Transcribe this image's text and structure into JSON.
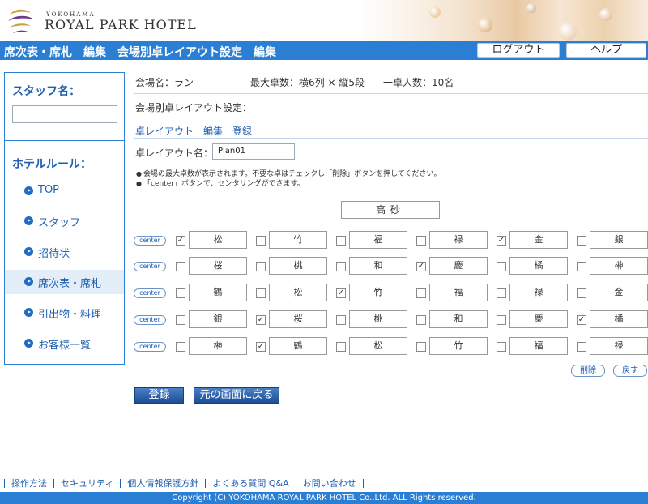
{
  "header": {
    "logo_small": "YOKOHAMA",
    "logo_big": "ROYAL PARK HOTEL"
  },
  "navbar": {
    "title": "席次表・席札　編集　会場別卓レイアウト設定　編集",
    "logout_label": "ログアウト",
    "help_label": "ヘルプ"
  },
  "sidebar": {
    "staff_label": "スタッフ名：",
    "rule_label": "ホテルルール：",
    "items": [
      {
        "label": "TOP"
      },
      {
        "label": "スタッフ"
      },
      {
        "label": "招待状"
      },
      {
        "label": "席次表・席札"
      },
      {
        "label": "引出物・料理"
      },
      {
        "label": "お客様一覧"
      }
    ]
  },
  "info": {
    "venue": "会場名：ラン",
    "max_tables": "最大卓数：横6列 × 縦5段",
    "per_table": "一卓人数：10名"
  },
  "section_title": "会場別卓レイアウト設定：",
  "crumb": "卓レイアウト　編集　登録",
  "layout_name_label": "卓レイアウト名：",
  "layout_name_value": "Plan01",
  "notes": [
    "会場の最大卓数が表示されます。不要な卓はチェックし「削除」ボタンを押してください。",
    "「center」ボタンで、センタリングができます。"
  ],
  "stage_label": "高砂",
  "center_label": "center",
  "grid": [
    [
      {
        "name": "松",
        "checked": true
      },
      {
        "name": "竹",
        "checked": false
      },
      {
        "name": "福",
        "checked": false
      },
      {
        "name": "禄",
        "checked": false
      },
      {
        "name": "金",
        "checked": true
      },
      {
        "name": "銀",
        "checked": false
      }
    ],
    [
      {
        "name": "桜",
        "checked": false
      },
      {
        "name": "桃",
        "checked": false
      },
      {
        "name": "和",
        "checked": false
      },
      {
        "name": "慶",
        "checked": true
      },
      {
        "name": "橘",
        "checked": false
      },
      {
        "name": "榊",
        "checked": false
      }
    ],
    [
      {
        "name": "鶴",
        "checked": false
      },
      {
        "name": "松",
        "checked": false
      },
      {
        "name": "竹",
        "checked": true
      },
      {
        "name": "福",
        "checked": false
      },
      {
        "name": "禄",
        "checked": false
      },
      {
        "name": "金",
        "checked": false
      }
    ],
    [
      {
        "name": "銀",
        "checked": false
      },
      {
        "name": "桜",
        "checked": true
      },
      {
        "name": "桃",
        "checked": false
      },
      {
        "name": "和",
        "checked": false
      },
      {
        "name": "慶",
        "checked": false
      },
      {
        "name": "橘",
        "checked": true
      }
    ],
    [
      {
        "name": "榊",
        "checked": false
      },
      {
        "name": "鶴",
        "checked": true
      },
      {
        "name": "松",
        "checked": false
      },
      {
        "name": "竹",
        "checked": false
      },
      {
        "name": "福",
        "checked": false
      },
      {
        "name": "禄",
        "checked": false
      }
    ]
  ],
  "buttons": {
    "delete": "削除",
    "undo": "戻す",
    "register": "登録",
    "back": "元の画面に戻る"
  },
  "footer": {
    "links": [
      "操作方法",
      "セキュリティ",
      "個人情報保護方針",
      "よくある質問 Q&A",
      "お問い合わせ"
    ],
    "copyright": "Copyright (C) YOKOHAMA ROYAL PARK HOTEL Co.,Ltd. ALL Rights reserved."
  },
  "colors": {
    "nav_blue": "#2a7fd4",
    "link_blue": "#1f5fb0"
  }
}
